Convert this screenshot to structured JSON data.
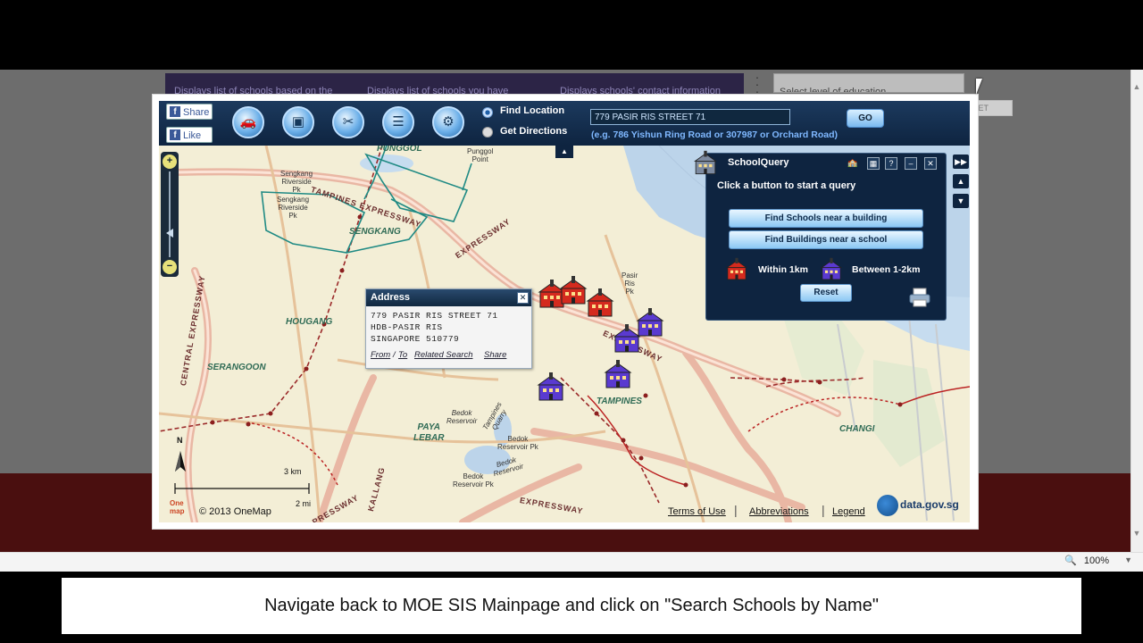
{
  "background_page": {
    "tabs": [
      "Displays list of schools based on the",
      "Displays list of schools you have",
      "Displays schools' contact information"
    ],
    "level_select": {
      "value": "Select level of education"
    },
    "reset_label": "RESET"
  },
  "toolbar": {
    "facebook_share": "Share",
    "facebook_like": "Like",
    "tools": [
      {
        "icon": "car-icon"
      },
      {
        "icon": "layers-icon"
      },
      {
        "icon": "tools-icon"
      },
      {
        "icon": "list-icon"
      },
      {
        "icon": "settings-icon"
      }
    ],
    "mode_find_location": "Find Location",
    "mode_get_directions": "Get Directions",
    "search_value": "779 PASIR RIS STREET 71",
    "search_example": "(e.g. 786 Yishun Ring Road or 307987 or Orchard Road)",
    "go_label": "GO"
  },
  "map": {
    "labels": {
      "punggol": "PUNGGOL",
      "sengkang": "SENGKANG",
      "sengkang_riverside_1": "Sengkang\nRiverside\nPk",
      "sengkang_riverside_2": "Sengkang\nRiverside\nPk",
      "hougang": "HOUGANG",
      "serangoon": "SERANGOON",
      "paya_lebar": "PAYA\nLEBAR",
      "tampines": "TAMPINES",
      "changi": "CHANGI",
      "pasir_ris_pk": "Pasir\nRis\nPk",
      "bedok_reservoir": "Bedok\nReservoir",
      "bedok_reservoir_pk": "Bedok\nReservoir Pk",
      "bedok_reservoir_2": "Bedok\nReservoir",
      "bedok_reservoir_pk_2": "Bedok\nReservoir Pk",
      "tampines_quarry": "Tampines\nQuarry",
      "tampines_expressway": "TAMPINES EXPRESSWAY",
      "expressway_east": "EXPRESSWAY",
      "central_expressway": "CENTRAL EXPRESSWAY",
      "kallang_expressway": "KALLANG",
      "pie_expressway": "EXPRESSWAY",
      "pressway": "PRESSWAY",
      "punggol_point": "Punggol\nPoint"
    },
    "scale_km": "3 km",
    "scale_mi": "2 mi",
    "north": "N",
    "copyright": "© 2013 OneMap",
    "logo": "One map",
    "terms": "Terms of Use",
    "abbreviations": "Abbreviations",
    "legend": "Legend",
    "datagov": "data.gov.sg"
  },
  "address_popup": {
    "title": "Address",
    "line1": "779 PASIR RIS STREET 71",
    "line2": "HDB-PASIR RIS",
    "line3": "SINGAPORE 510779",
    "link_from": "From",
    "link_to": "To",
    "link_related": "Related Search",
    "link_share": "Share"
  },
  "school_query": {
    "title": "SchoolQuery",
    "instruction": "Click a button to start a query",
    "btn_schools_near_building": "Find Schools near a building",
    "btn_buildings_near_school": "Find Buildings near a school",
    "legend_within": "Within 1km",
    "legend_between": "Between 1-2km",
    "reset": "Reset"
  },
  "status_bar": {
    "zoom": "100%"
  },
  "caption": "Navigate back to MOE SIS Mainpage and click on \"Search Schools by Name\"",
  "colors": {
    "toolbar": "#0e2440",
    "school_near": "#d42a1e",
    "school_far": "#5a3ad0",
    "map_bg": "#f3eed6",
    "water": "#bcd4ea"
  }
}
